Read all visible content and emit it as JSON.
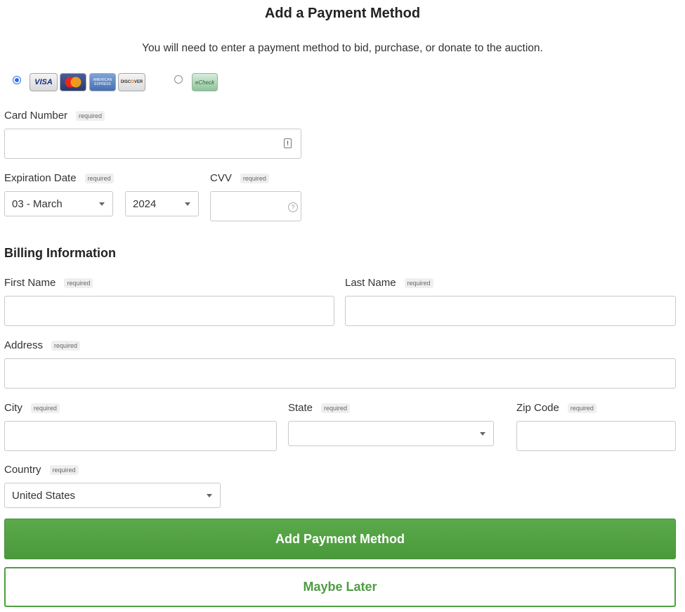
{
  "header": {
    "title": "Add a Payment Method",
    "subtitle": "You will need to enter a payment method to bid, purchase, or donate to the auction."
  },
  "payment_type": {
    "selected": "card",
    "cards": [
      "VISA",
      "MasterCard",
      "American Express",
      "DISCOVER"
    ],
    "echeck_label": "eCheck"
  },
  "card": {
    "number_label": "Card Number",
    "expiration_label": "Expiration Date",
    "month_value": "03 - March",
    "year_value": "2024",
    "cvv_label": "CVV",
    "required_tag": "required"
  },
  "billing": {
    "section_title": "Billing Information",
    "first_name_label": "First Name",
    "last_name_label": "Last Name",
    "address_label": "Address",
    "city_label": "City",
    "state_label": "State",
    "state_value": "",
    "zip_label": "Zip Code",
    "country_label": "Country",
    "country_value": "United States"
  },
  "actions": {
    "submit_label": "Add Payment Method",
    "later_label": "Maybe Later"
  },
  "colors": {
    "primary_button": "#52a244",
    "radio_selected": "#2f6fe0"
  }
}
